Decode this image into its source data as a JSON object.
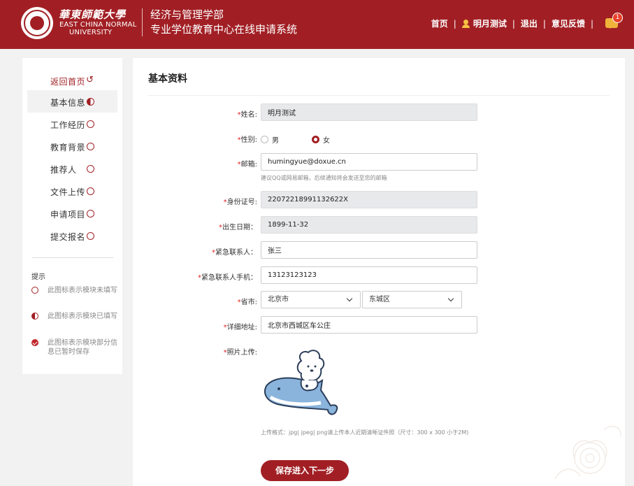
{
  "header": {
    "logo_cn": "華東師範大學",
    "logo_en_line1": "EAST CHINA NORMAL",
    "logo_en_line2": "UNIVERSITY",
    "dept_line1": "经济与管理学部",
    "dept_line2": "专业学位教育中心在线申请系统",
    "nav": {
      "home": "首页",
      "user": "明月测试",
      "logout": "退出",
      "feedback": "意见反馈",
      "separator": "|",
      "message_count": "1"
    }
  },
  "sidebar": {
    "back": "返回首页",
    "items": [
      {
        "label": "基本信息",
        "status": "half"
      },
      {
        "label": "工作经历",
        "status": "empty"
      },
      {
        "label": "教育背景",
        "status": "empty"
      },
      {
        "label": "推荐人",
        "status": "empty"
      },
      {
        "label": "文件上传",
        "status": "empty"
      },
      {
        "label": "申请项目",
        "status": "empty"
      },
      {
        "label": "提交报名",
        "status": "empty"
      }
    ],
    "tips_title": "提示",
    "tips": [
      {
        "icon": "empty-circle-icon",
        "text": "此图标表示模块未填写"
      },
      {
        "icon": "half-circle-icon",
        "text": "此图标表示模块已填写"
      },
      {
        "icon": "check-circle-icon",
        "text": "此图标表示模块部分信息已暂时保存"
      }
    ]
  },
  "form": {
    "title": "基本资料",
    "required_mark": "*",
    "fields": {
      "name": {
        "label": "姓名:",
        "value": "明月测试"
      },
      "gender": {
        "label": "性别:",
        "options": [
          "男",
          "女"
        ],
        "selected": "女"
      },
      "email": {
        "label": "邮箱:",
        "value": "humingyue@doxue.cn",
        "hint": "建议QQ或网易邮箱，后续通知将会发送至您的邮箱"
      },
      "id_number": {
        "label": "身份证号:",
        "value": "22072218991132622X"
      },
      "birth_date": {
        "label": "出生日期：",
        "value": "1899-11-32"
      },
      "emergency_contact": {
        "label": "紧急联系人：",
        "value": "张三"
      },
      "emergency_phone": {
        "label": "紧急联系人手机：",
        "value": "13123123123"
      },
      "province": {
        "label": "省市:",
        "city": "北京市",
        "district": "东城区"
      },
      "address": {
        "label": "详细地址:",
        "value": "北京市西城区车公庄"
      },
      "photo": {
        "label": "照片上传:",
        "note": "上传格式：jpg| jpeg| png请上传本人近期清晰证件照（尺寸：300 x 300 小于2M)"
      }
    },
    "submit": "保存进入下一步"
  },
  "colors": {
    "brand": "#a11f24",
    "required": "#e02020"
  }
}
